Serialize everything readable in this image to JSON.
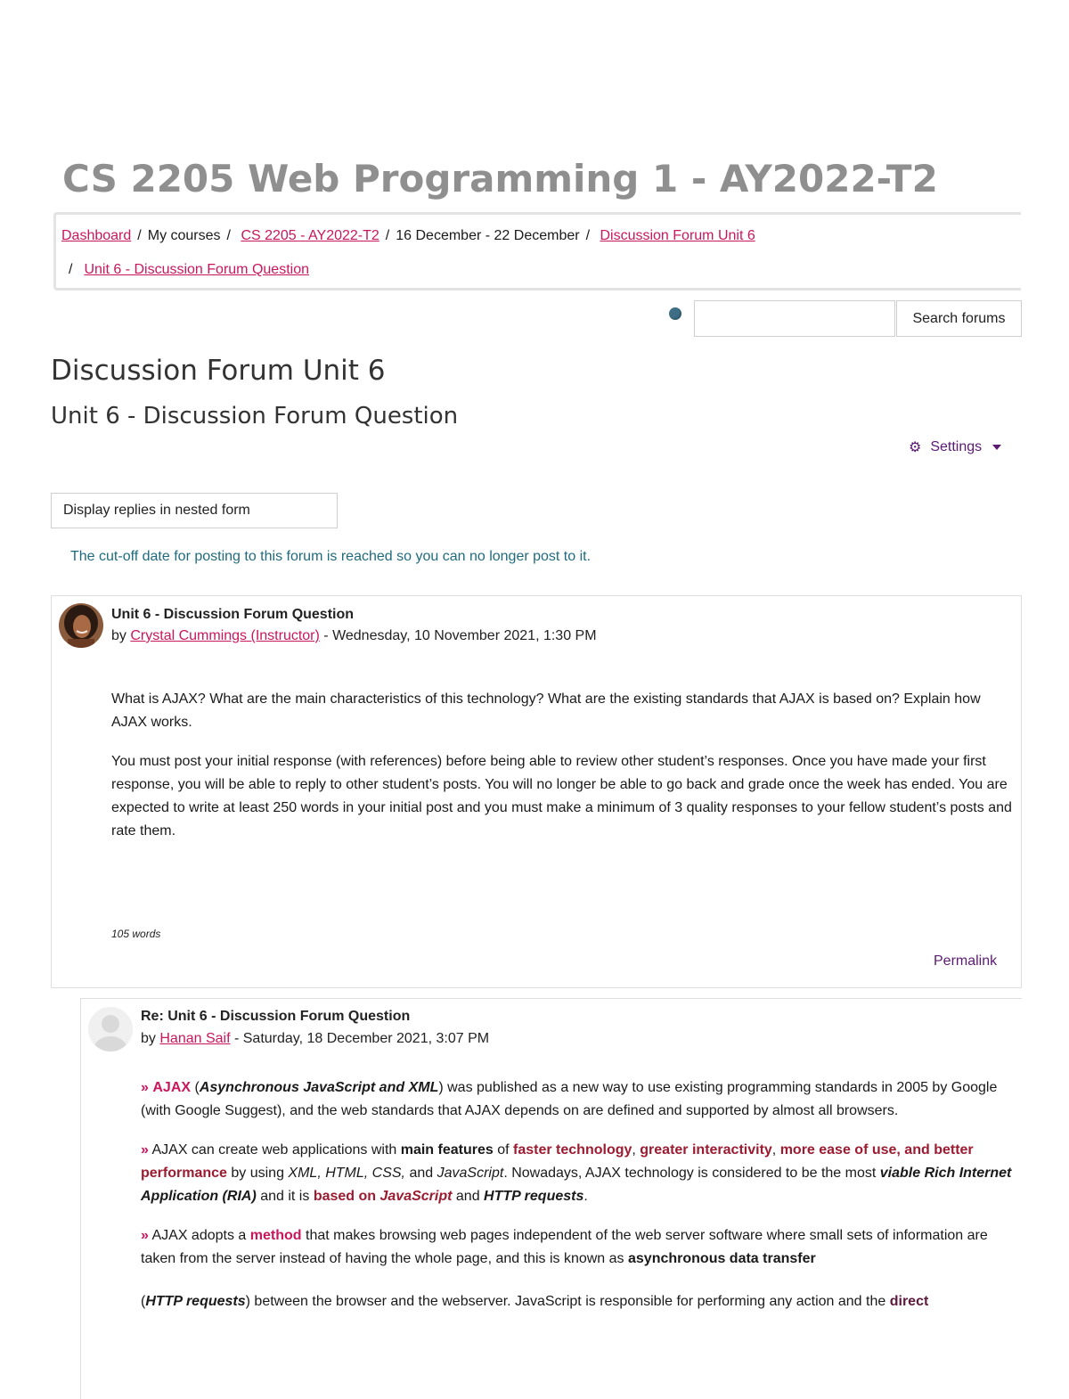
{
  "course_title": "CS 2205 Web Programming 1 - AY2022-T2",
  "breadcrumb": {
    "dashboard": "Dashboard",
    "my_courses": "My courses",
    "course": "CS 2205 - AY2022-T2",
    "week": "16 December - 22 December",
    "forum": "Discussion Forum Unit 6",
    "discussion": "Unit 6 - Discussion Forum Question",
    "separator": "/"
  },
  "search": {
    "placeholder": "",
    "button_label": "Search forums"
  },
  "forum_title": "Discussion Forum Unit 6",
  "discussion_title": "Unit 6 - Discussion Forum Question",
  "settings_label": "Settings",
  "display_mode": "Display replies in nested form",
  "cutoff_notice": "The cut-off date for posting to this forum is reached so you can no longer post to it.",
  "colors": {
    "link": "#c8175d",
    "settings": "#5b1a73",
    "notice": "#1f6b7d",
    "course_title": "#8f8f8f"
  },
  "main_post": {
    "subject": "Unit 6 - Discussion Forum Question",
    "by": "by",
    "author": "Crystal Cummings (Instructor)",
    "date": "- Wednesday, 10 November 2021, 1:30 PM",
    "paragraph1": "What is AJAX? What are the main characteristics of this technology? What are the existing standards that AJAX is based on? Explain how AJAX works.",
    "paragraph2": "You must post your initial response (with references) before being able to review other student’s responses.  Once you have made your first response, you will be able to reply to other student’s posts.  You will no longer be able to go back and grade once the week has ended.  You are expected to write at least 250 words in your initial post and you must make a minimum of 3 quality responses to your fellow student’s posts and rate them.",
    "word_count": "105 words",
    "permalink": "Permalink"
  },
  "reply_post": {
    "subject": "Re: Unit 6 - Discussion Forum Question",
    "by": "by",
    "author": "Hanan Saif",
    "date": "- Saturday, 18 December 2021, 3:07 PM",
    "bullet": "»",
    "p1": {
      "term": "AJAX",
      "expansion": "Asynchronous JavaScript and XML",
      "text": "was published as a new way to use existing programming standards in 2005 by Google (with Google Suggest), and the web standards that AJAX depends on are defined and supported by almost all browsers."
    },
    "p2": {
      "t1": "AJAX can create web applications with",
      "b1": "main features",
      "t2": "of",
      "h1": "faster technology",
      "h2": "greater interactivity",
      "h3": "more ease of use, and",
      "b2": "better performance",
      "t3": "by using",
      "techs": "XML, HTML, CSS,",
      "t4": "and",
      "js": "JavaScript",
      "t5": ". Nowadays, AJAX technology is considered to be the most",
      "ria": "viable Rich Internet Application (RIA)",
      "t6": "and it is",
      "b3": "based on",
      "js2": "JavaScript",
      "t7": "and",
      "http": "HTTP requests",
      "t8": "."
    },
    "p3": {
      "t1": "AJAX adopts a",
      "h1": "method",
      "t2": "that makes browsing web pages independent of the web server software where small sets of information are taken from the server instead of having the whole page, and this is known as",
      "b1": "asynchronous data transfer"
    },
    "p4": {
      "open": "(",
      "http": "HTTP requests",
      "t1": ") between the browser and the webserver. JavaScript is responsible for performing any action and the",
      "b1": "direct"
    }
  }
}
